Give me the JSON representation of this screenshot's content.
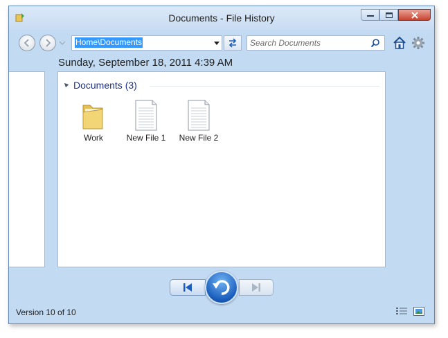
{
  "window": {
    "title": "Documents - File History"
  },
  "toolbar": {
    "address": "Home\\Documents",
    "search_placeholder": "Search Documents"
  },
  "timestamp": "Sunday, September 18, 2011 4:39 AM",
  "group": {
    "title": "Documents (3)"
  },
  "items": [
    {
      "label": "Work",
      "icon": "folder-icon"
    },
    {
      "label": "New File 1",
      "icon": "file-icon"
    },
    {
      "label": "New File 2",
      "icon": "file-icon"
    }
  ],
  "status": {
    "version": "Version 10 of 10"
  },
  "colors": {
    "accent": "#1e3287",
    "restore": "#1a5dbb",
    "selection": "#3399ff"
  }
}
